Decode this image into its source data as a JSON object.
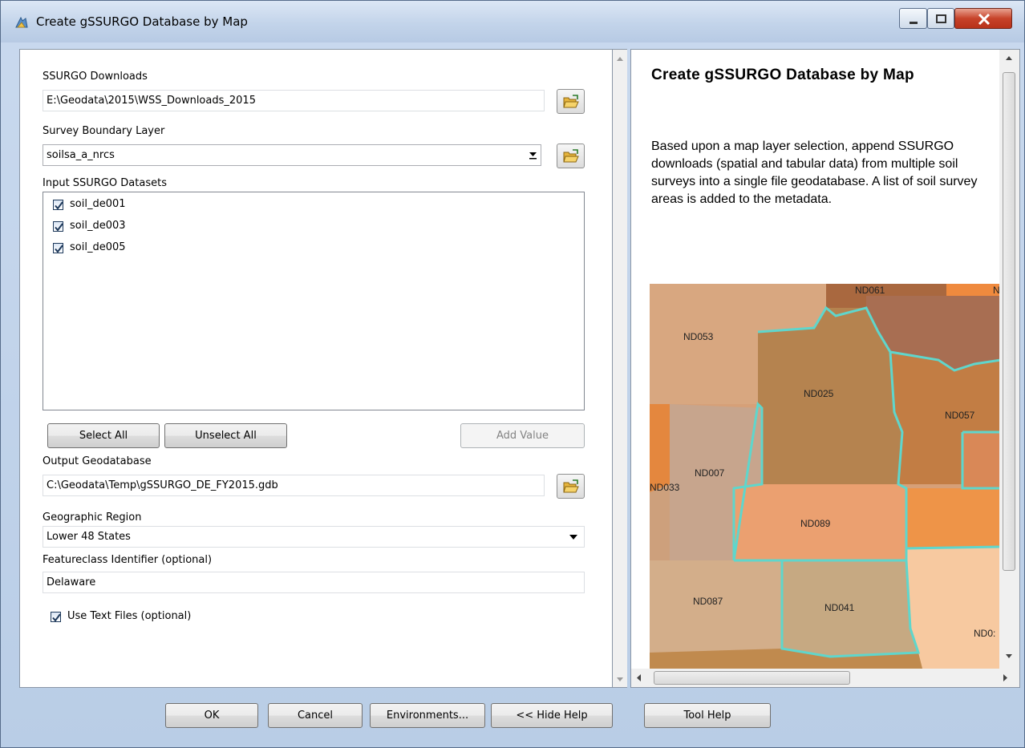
{
  "window": {
    "title": "Create gSSURGO Database by Map"
  },
  "form": {
    "ssurgo_downloads": {
      "label": "SSURGO Downloads",
      "value": "E:\\Geodata\\2015\\WSS_Downloads_2015"
    },
    "survey_boundary": {
      "label": "Survey Boundary Layer",
      "value": "soilsa_a_nrcs"
    },
    "input_datasets": {
      "label": "Input SSURGO Datasets",
      "items": [
        {
          "label": "soil_de001",
          "checked": true
        },
        {
          "label": "soil_de003",
          "checked": true
        },
        {
          "label": "soil_de005",
          "checked": true
        }
      ]
    },
    "buttons": {
      "select_all": "Select All",
      "unselect_all": "Unselect All",
      "add_value": "Add Value"
    },
    "output_gdb": {
      "label": "Output Geodatabase",
      "value": "C:\\Geodata\\Temp\\gSSURGO_DE_FY2015.gdb"
    },
    "geo_region": {
      "label": "Geographic Region",
      "value": "Lower 48 States"
    },
    "featureclass_id": {
      "label": "Featureclass Identifier (optional)",
      "value": "Delaware"
    },
    "use_text_files": {
      "label": "Use Text Files (optional)",
      "checked": true
    }
  },
  "help": {
    "title": "Create gSSURGO Database by Map",
    "description": "Based upon a map layer selection, append SSURGO downloads (spatial and tabular data) from multiple soil surveys into a single file geodatabase. A list of soil survey areas is added to the metadata.",
    "map_labels": [
      "ND061",
      "N",
      "ND053",
      "ND025",
      "ND057",
      "ND007",
      "ND033",
      "ND089",
      "ND087",
      "ND041",
      "ND0:"
    ]
  },
  "footer": {
    "ok": "OK",
    "cancel": "Cancel",
    "environments": "Environments...",
    "hide_help": "<< Hide Help",
    "tool_help": "Tool Help"
  },
  "colors": {
    "selection_outline": "#5fd6cc",
    "accent": "#1e395b"
  },
  "icons": [
    "app-icon",
    "minimize-icon",
    "maximize-icon",
    "close-icon",
    "open-folder-icon",
    "dropdown-arrow-icon",
    "checkmark-icon"
  ]
}
